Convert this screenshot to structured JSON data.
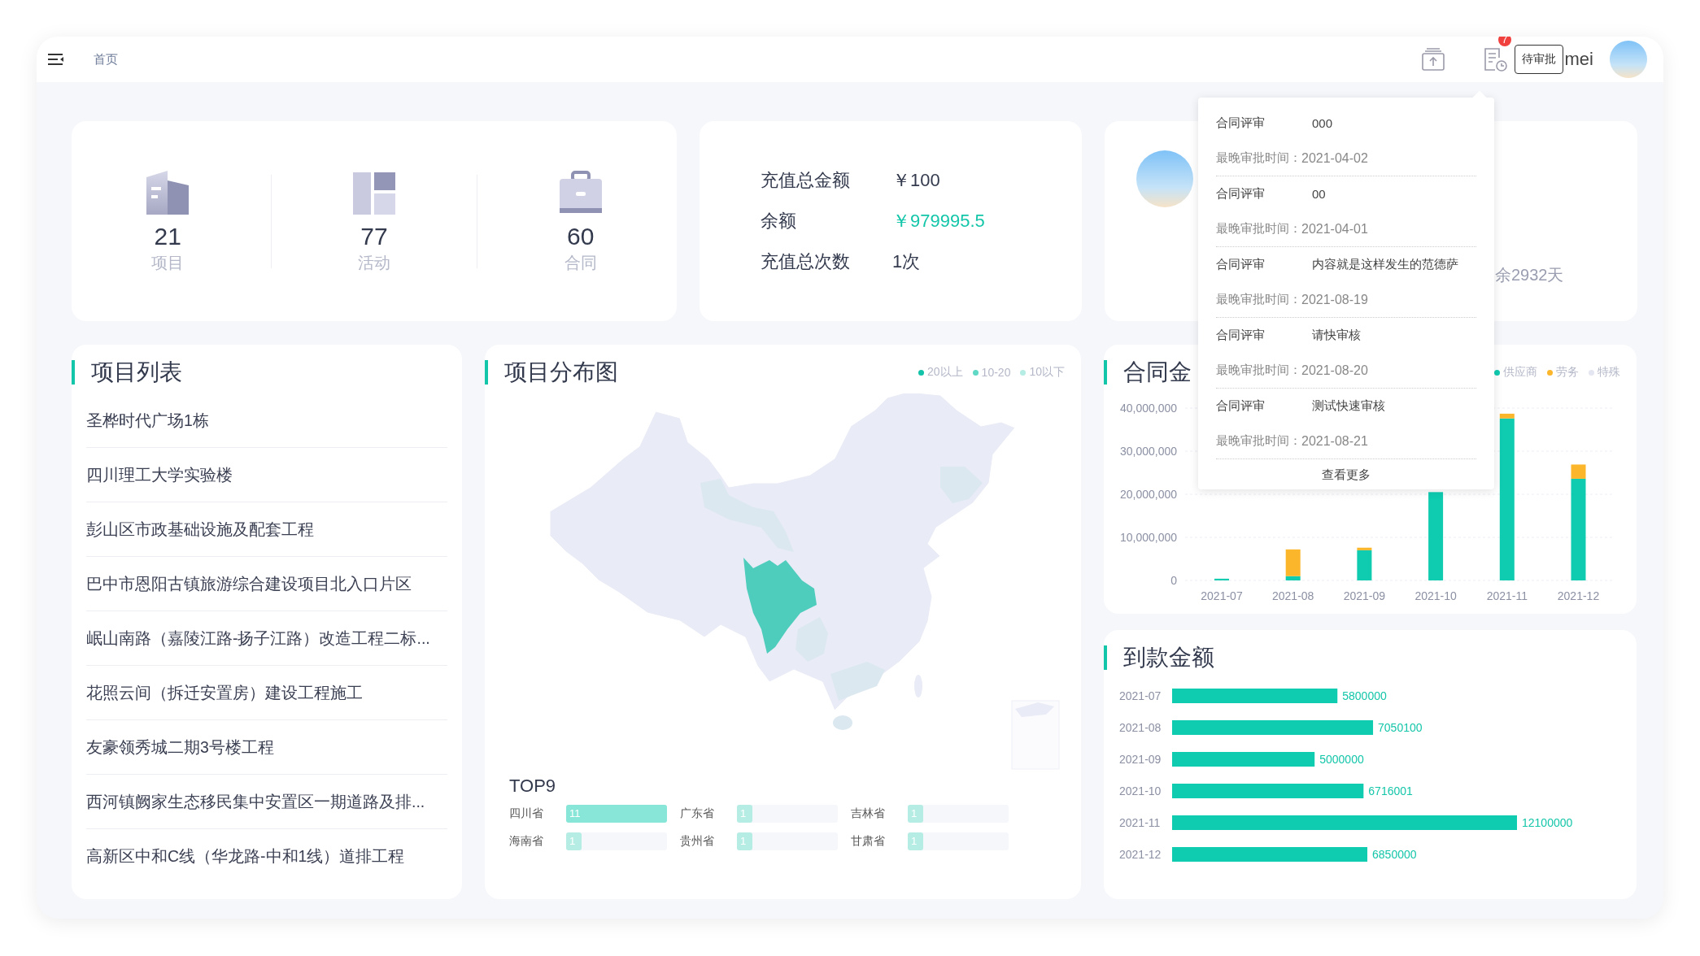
{
  "topbar": {
    "breadcrumb": "首页",
    "badge": "7",
    "tooltip": "待审批",
    "user_name": "mei"
  },
  "stats": [
    {
      "kind": "building",
      "value": "21",
      "label": "项目"
    },
    {
      "kind": "layout",
      "value": "77",
      "label": "活动"
    },
    {
      "kind": "briefcase",
      "value": "60",
      "label": "合同"
    }
  ],
  "recharge": {
    "rows": [
      {
        "label": "充值总金额",
        "value": "￥100",
        "accent": false
      },
      {
        "label": "余额",
        "value": "￥979995.5",
        "accent": true
      },
      {
        "label": "充值总次数",
        "value": "1次",
        "accent": false
      }
    ]
  },
  "profile": {
    "remaining": "余2932天"
  },
  "approvals": {
    "items": [
      {
        "type": "合同评审",
        "title": "000",
        "deadline_label": "最晚审批时间：",
        "deadline": "2021-04-02"
      },
      {
        "type": "合同评审",
        "title": "00",
        "deadline_label": "最晚审批时间：",
        "deadline": "2021-04-01"
      },
      {
        "type": "合同评审",
        "title": "内容就是这样发生的范德萨",
        "deadline_label": "最晚审批时间：",
        "deadline": "2021-08-19"
      },
      {
        "type": "合同评审",
        "title": "请快审核",
        "deadline_label": "最晚审批时间：",
        "deadline": "2021-08-20"
      },
      {
        "type": "合同评审",
        "title": "测试快速审核",
        "deadline_label": "最晚审批时间：",
        "deadline": "2021-08-21"
      }
    ],
    "more": "查看更多"
  },
  "project_list": {
    "title": "项目列表",
    "items": [
      "圣桦时代广场1栋",
      "四川理工大学实验楼",
      "彭山区市政基础设施及配套工程",
      "巴中市恩阳古镇旅游综合建设项目北入口片区",
      "岷山南路（嘉陵江路-扬子江路）改造工程二标...",
      "花照云间（拆迁安置房）建设工程施工",
      "友豪领秀城二期3号楼工程",
      "西河镇阙家生态移民集中安置区一期道路及排...",
      "高新区中和C线（华龙路-中和1线）道排工程"
    ]
  },
  "distribution": {
    "title": "项目分布图",
    "legend": [
      {
        "label": "20以上",
        "color": "#12c2a9"
      },
      {
        "label": "10-20",
        "color": "#5fd8c6"
      },
      {
        "label": "10以下",
        "color": "#b5ede4"
      }
    ],
    "top_title": "TOP9",
    "top": [
      {
        "name": "四川省",
        "count": "11",
        "level": 1
      },
      {
        "name": "广东省",
        "count": "1",
        "level": 0.15
      },
      {
        "name": "吉林省",
        "count": "1",
        "level": 0.15
      },
      {
        "name": "海南省",
        "count": "1",
        "level": 0.15
      },
      {
        "name": "贵州省",
        "count": "1",
        "level": 0.15
      },
      {
        "name": "甘肃省",
        "count": "1",
        "level": 0.15
      }
    ]
  },
  "contract_amount": {
    "title": "合同金",
    "chart_data": {
      "type": "bar",
      "stacked": true,
      "categories": [
        "2021-07",
        "2021-08",
        "2021-09",
        "2021-10",
        "2021-11",
        "2021-12"
      ],
      "series": [
        {
          "name": "供应商",
          "color": "#0fcbb0",
          "values": [
            400000,
            1000000,
            7000000,
            20500000,
            37600000,
            23600000
          ]
        },
        {
          "name": "劳务",
          "color": "#fcb62b",
          "values": [
            0,
            6200000,
            600000,
            0,
            1100000,
            3300000
          ]
        },
        {
          "name": "特殊",
          "color": "#e4e6f1",
          "values": [
            0,
            0,
            0,
            0,
            0,
            0
          ]
        }
      ],
      "ylim": [
        0,
        40000000
      ],
      "grid": true,
      "yticks": [
        {
          "value": 0,
          "label": "0"
        },
        {
          "value": 10000000,
          "label": "10,000,000"
        },
        {
          "value": 20000000,
          "label": "20,000,000"
        },
        {
          "value": 30000000,
          "label": "30,000,000"
        },
        {
          "value": 40000000,
          "label": "40,000,000"
        }
      ]
    }
  },
  "payment": {
    "title": "到款金额",
    "chart_data": {
      "type": "bar",
      "orientation": "horizontal",
      "categories": [
        "2021-07",
        "2021-08",
        "2021-09",
        "2021-10",
        "2021-11",
        "2021-12"
      ],
      "values": [
        5800000,
        7050100,
        5000000,
        6716001,
        12100000,
        6850000
      ],
      "data_labels": true
    }
  }
}
